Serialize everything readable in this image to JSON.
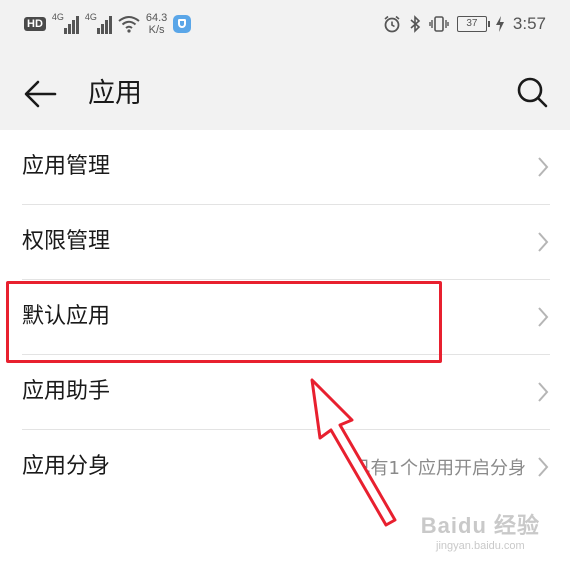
{
  "status_bar": {
    "hd": "HD",
    "sig1_label": "4G",
    "sig2_label": "4G",
    "net_speed_value": "64.3",
    "net_speed_unit": "K/s",
    "battery": "37",
    "time": "3:57",
    "icons": [
      "wifi-icon",
      "shield-app-icon",
      "alarm-icon",
      "bluetooth-icon",
      "vibrate-icon",
      "charging-icon"
    ]
  },
  "header": {
    "title": "应用"
  },
  "list": {
    "items": [
      {
        "label": "应用管理",
        "sub": ""
      },
      {
        "label": "权限管理",
        "sub": ""
      },
      {
        "label": "默认应用",
        "sub": ""
      },
      {
        "label": "应用助手",
        "sub": ""
      },
      {
        "label": "应用分身",
        "sub": "已有1个应用开启分身"
      }
    ]
  },
  "annotation": {
    "highlight_color": "#e8202f",
    "highlighted_item": "默认应用"
  },
  "watermark": {
    "main": "Baidu 经验",
    "sub": "jingyan.baidu.com"
  }
}
